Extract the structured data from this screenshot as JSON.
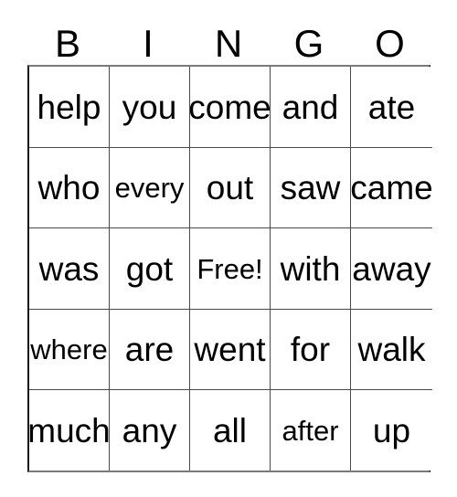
{
  "card": {
    "headers": [
      "B",
      "I",
      "N",
      "G",
      "O"
    ],
    "rows": [
      [
        "help",
        "you",
        "come",
        "and",
        "ate"
      ],
      [
        "who",
        "every",
        "out",
        "saw",
        "came"
      ],
      [
        "was",
        "got",
        "Free!",
        "with",
        "away"
      ],
      [
        "where",
        "are",
        "went",
        "for",
        "walk"
      ],
      [
        "much",
        "any",
        "all",
        "after",
        "up"
      ]
    ],
    "free_space": "Free!",
    "free_space_position": {
      "row": 2,
      "col": 2
    },
    "colors": {
      "background": "#ffffff",
      "text": "#000000",
      "grid_line": "#4a4a4a",
      "outer_border": "#1a1a1a"
    }
  }
}
